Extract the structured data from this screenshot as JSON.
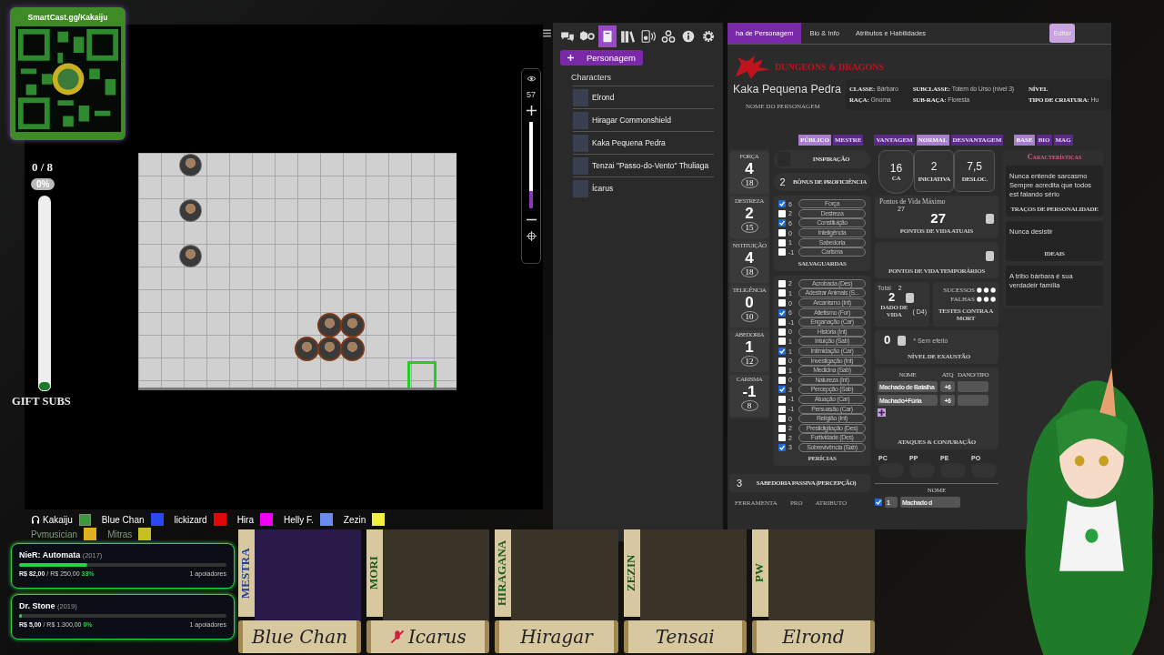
{
  "qr_card": {
    "url": "SmartCast.gg/Kakaiju"
  },
  "gift_subs": {
    "count": "0 / 8",
    "percent": "0%",
    "level": 0,
    "label": "GIFT SUBS"
  },
  "map": {
    "zoom": {
      "value": "57",
      "level": 0.2
    }
  },
  "journal": {
    "tools": [
      {
        "kind": "chat",
        "selected": false
      },
      {
        "kind": "dice",
        "selected": false
      },
      {
        "kind": "journal",
        "selected": true
      },
      {
        "kind": "compendium",
        "selected": false
      },
      {
        "kind": "jukebox",
        "selected": false
      },
      {
        "kind": "collections",
        "selected": false
      },
      {
        "kind": "info",
        "selected": false
      },
      {
        "kind": "settings",
        "selected": false
      }
    ],
    "add_button": "Personagem",
    "folder": "Characters",
    "characters": [
      {
        "name": "Elrond"
      },
      {
        "name": "Hiragar Commonshield"
      },
      {
        "name": "Kaka Pequena Pedra"
      },
      {
        "name": "Tenzai \"Passo-do-Vento\" Thuliaga"
      },
      {
        "name": "Ícarus"
      }
    ]
  },
  "sheet": {
    "tabs": [
      {
        "label": "ha de Personagem",
        "selected": true
      },
      {
        "label": "Bio & Info",
        "selected": false
      },
      {
        "label": "Atributos e Habilidades",
        "selected": false
      }
    ],
    "edit_button": "Editar",
    "logo": "DUNGEONS & DRAGONS",
    "character_name": "Kaka Pequena Pedra",
    "name_label": "NOME DO PERSONAGEM",
    "info": [
      {
        "label": "CLASSE:",
        "value": "Bárbaro"
      },
      {
        "label": "SUBCLASSE:",
        "value": "Totem do Urso (nível 3)"
      },
      {
        "label": "NÍVEL"
      },
      {
        "label": "RAÇA:",
        "value": "Gnoma"
      },
      {
        "label": "SUB-RAÇA:",
        "value": "Floresta"
      },
      {
        "label": "TIPO DE CRIATURA:",
        "value": "Hu"
      }
    ],
    "toggle_groups": [
      [
        {
          "label": "PÚBLICO",
          "selected": true
        },
        {
          "label": "MESTRE",
          "selected": false
        }
      ],
      [
        {
          "label": "VANTAGEM",
          "selected": false
        },
        {
          "label": "NORMAL",
          "selected": true
        },
        {
          "label": "DESVANTAGEM",
          "selected": false
        }
      ],
      [
        {
          "label": "BASE",
          "selected": true
        },
        {
          "label": "BIO",
          "selected": false
        },
        {
          "label": "MAG",
          "selected": false
        }
      ]
    ],
    "abilities": [
      {
        "label": "FORÇA",
        "modifier": "4",
        "score": "18"
      },
      {
        "label": "DESTREZA",
        "modifier": "2",
        "score": "15"
      },
      {
        "label": "NSTITUIÇÃO",
        "modifier": "4",
        "score": "18"
      },
      {
        "label": "TELIGÊNCIA",
        "modifier": "0",
        "score": "10"
      },
      {
        "label": "ABEDORIA",
        "modifier": "1",
        "score": "12"
      },
      {
        "label": "CARISMA",
        "modifier": "-1",
        "score": "8"
      }
    ],
    "inspiration_label": "INSPIRAÇÃO",
    "proficiency": {
      "value": "2",
      "label": "BÔNUS DE PROFICIÊNCIA"
    },
    "saves_title": "SALVAGUARDAS",
    "saves": [
      {
        "checked": true,
        "value": "6",
        "name": "Força"
      },
      {
        "checked": false,
        "value": "2",
        "name": "Destreza"
      },
      {
        "checked": true,
        "value": "6",
        "name": "Constituição"
      },
      {
        "checked": false,
        "value": "0",
        "name": "Inteligência"
      },
      {
        "checked": false,
        "value": "1",
        "name": "Sabedoria"
      },
      {
        "checked": false,
        "value": "-1",
        "name": "Carisma"
      }
    ],
    "skills_title": "PERÍCIAS",
    "skills": [
      {
        "checked": false,
        "value": "2",
        "name": "Acrobacia (Des)"
      },
      {
        "checked": false,
        "value": "1",
        "name": "Adestrar Animais (S..."
      },
      {
        "checked": false,
        "value": "0",
        "name": "Arcanismo (Int)"
      },
      {
        "checked": true,
        "value": "6",
        "name": "Atletismo (For)"
      },
      {
        "checked": false,
        "value": "-1",
        "name": "Enganação (Car)"
      },
      {
        "checked": false,
        "value": "0",
        "name": "História (Int)"
      },
      {
        "checked": false,
        "value": "1",
        "name": "Intuição (Sab)"
      },
      {
        "checked": true,
        "value": "1",
        "name": "Intimidação (Car)"
      },
      {
        "checked": false,
        "value": "0",
        "name": "Investigação (Int)"
      },
      {
        "checked": false,
        "value": "1",
        "name": "Medicina (Sab)"
      },
      {
        "checked": false,
        "value": "0",
        "name": "Natureza (Int)"
      },
      {
        "checked": true,
        "value": "3",
        "name": "Percepção (Sab)"
      },
      {
        "checked": false,
        "value": "-1",
        "name": "Atuação (Car)"
      },
      {
        "checked": false,
        "value": "-1",
        "name": "Persuasão (Car)"
      },
      {
        "checked": false,
        "value": "0",
        "name": "Religião (Int)"
      },
      {
        "checked": false,
        "value": "2",
        "name": "Prestidigitação (Des)"
      },
      {
        "checked": false,
        "value": "2",
        "name": "Furtividade (Des)"
      },
      {
        "checked": true,
        "value": "3",
        "name": "Sobrevivência (Sab)"
      }
    ],
    "passive": {
      "value": "3",
      "label": "SABEDORIA PASSIVA (PERCEPÇÃO)"
    },
    "tools_headers": [
      "FERRAMENTA",
      "PRO",
      "ATRIBUTO"
    ],
    "combat": [
      {
        "kind": "shield",
        "value": "16",
        "label": "CA"
      },
      {
        "kind": "box",
        "value": "2",
        "label": "INICIATIVA"
      },
      {
        "kind": "box",
        "value": "7,5",
        "label": "DESLOC."
      }
    ],
    "hp": {
      "max_label": "Pontos de Vida Máximo",
      "max": "27",
      "current": "27",
      "current_label": "PONTOS DE VIDA ATUAIS",
      "temp_label": "PONTOS DE VIDA TEMPORÁRIOS"
    },
    "hit_dice": {
      "total_label": "Total",
      "total": "2",
      "value": "2",
      "label": "DADO DE VIDA",
      "die": "( D4)"
    },
    "death_saves": {
      "successes": "SUCESSOS",
      "failures": "FALHAS",
      "label": "TESTES CONTRA A MORT"
    },
    "exhaustion": {
      "value": "0",
      "effect": "* Sem efeito",
      "label": "NÍVEL DE EXAUSTÃO"
    },
    "attacks": {
      "headers": [
        "NOME",
        "ATQ",
        "DANO/TIPO"
      ],
      "rows": [
        {
          "name": "Machado de Batalha",
          "bonus": "+6"
        },
        {
          "name": "Machado+Fúria",
          "bonus": "+6"
        }
      ],
      "label": "ATAQUES & CONJURAÇÃO"
    },
    "coins": [
      "PC",
      "PP",
      "PE",
      "PO"
    ],
    "inventory": {
      "header": "NOME",
      "rows": [
        {
          "checked": true,
          "qty": "1",
          "name": "Machado d"
        }
      ]
    },
    "traits_title": "Características",
    "traits": [
      {
        "text": "Nunca entende sarcasmo Sempre acredita que todos est falando sério",
        "label": "TRAÇOS DE PERSONALIDADE"
      },
      {
        "text": "Nunca desistir",
        "label": "IDEAIS"
      },
      {
        "text": "A tribo bárbara é sua verdadeir família"
      }
    ]
  },
  "voice": [
    {
      "kind": "host",
      "name": "Kakaiju",
      "color": "#3a9a3a",
      "dimmed": false
    },
    {
      "kind": "guest",
      "name": "Blue Chan",
      "color": "#2a48f0",
      "dimmed": false
    },
    {
      "kind": "guest",
      "name": "lickizard",
      "color": "#e00808",
      "dimmed": false
    },
    {
      "kind": "guest",
      "name": "Hira",
      "color": "#f000f0",
      "dimmed": false
    },
    {
      "kind": "guest",
      "name": "Helly F.",
      "color": "#6a8cf0",
      "dimmed": false
    },
    {
      "kind": "guest",
      "name": "Zezin",
      "color": "#f0f040",
      "dimmed": false
    },
    {
      "kind": "guest",
      "name": "Pvmusician",
      "color": "#e0b020",
      "dimmed": true
    },
    {
      "kind": "guest",
      "name": "Mitras",
      "color": "#c8c020",
      "dimmed": true
    }
  ],
  "goals": [
    {
      "title": "NieR: Automata",
      "year": "(2017)",
      "raised": "R$ 82,00",
      "target": "/ R$ 250,00",
      "percent": "33%",
      "level": 0.33,
      "supporters": "1 apoiadores"
    },
    {
      "title": "Dr. Stone",
      "year": "(2019)",
      "raised": "R$ 5,00",
      "target": "/ R$ 1.300,00",
      "percent": "0%",
      "level": 0,
      "supporters": "1 apoiadores"
    }
  ],
  "party": [
    {
      "role": "MESTRA",
      "name": "Blue Chan",
      "muted": false
    },
    {
      "role": "MORI",
      "name": "Icarus",
      "muted": true
    },
    {
      "role": "HIRAGANA",
      "name": "Hiragar",
      "muted": false
    },
    {
      "role": "ZEZIN",
      "name": "Tensai",
      "muted": false
    },
    {
      "role": "PW",
      "name": "Elrond",
      "muted": false
    }
  ]
}
